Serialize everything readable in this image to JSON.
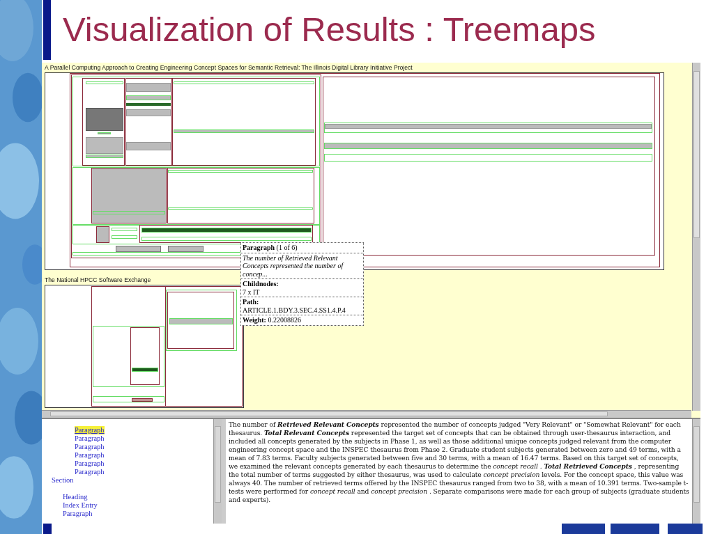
{
  "slide_title": "Visualization of Results : Treemaps",
  "treemaps": [
    {
      "title": "A Parallel Computing Approach to Creating Engineering Concept Spaces for Semantic Retrieval: The Illinois Digital Library Initiative Project"
    },
    {
      "title": "The National HPCC Software Exchange"
    }
  ],
  "tooltip": {
    "heading": "Paragraph",
    "count": "(1 of 6)",
    "snippet": "The number of Retrieved Relevant Concepts represented the number of concep...",
    "childnodes_label": "Childnodes:",
    "childnodes": "7 x IT",
    "path_label": "Path:",
    "path": "ARTICLE.1.BDY.3.SEC.4.SS1.4.P.4",
    "weight_label": "Weight:",
    "weight": "0.22008826"
  },
  "outline": [
    {
      "children": [
        {
          "label": "Paragraph",
          "selected": true
        },
        {
          "label": "Paragraph",
          "selected": false
        },
        {
          "label": "Paragraph",
          "selected": false
        },
        {
          "label": "Paragraph",
          "selected": false
        },
        {
          "label": "Paragraph",
          "selected": false
        },
        {
          "label": "Paragraph",
          "selected": false
        }
      ]
    },
    {
      "label": "Section",
      "selected": false,
      "children": [
        {
          "label": "Heading",
          "selected": false
        },
        {
          "label": "Index Entry",
          "selected": false
        },
        {
          "label": "Paragraph",
          "selected": false
        }
      ]
    }
  ],
  "document_text": "The number of **Retrieved Relevant Concepts** represented the number of concepts judged \"Very Relevant\" or \"Somewhat Relevant\" for each thesaurus. **Total Relevant Concepts** represented the target set of concepts that can be obtained through user-thesaurus interaction, and included all concepts generated by the subjects in Phase 1, as well as those additional unique concepts judged relevant from the computer engineering concept space and the INSPEC thesaurus from Phase 2. Graduate student subjects generated between zero and 49 terms, with a mean of 7.83 terms. Faculty subjects generated between five and 30 terms, with a mean of 16.47 terms. Based on this target set of concepts, we examined the relevant concepts generated by each thesaurus to determine the *concept recall* . **Total Retrieved Concepts** , representing the total number of terms suggested by either thesaurus, was used to calculate *concept precision* levels. For the concept space, this value was always 40. The number of retrieved terms offered by the INSPEC thesaurus ranged from two to 38, with a mean of 10.391 terms. Two-sample t-tests were performed for *concept recall* and *concept precision* . Separate comparisons were made for each group of subjects (graduate students and experts)."
}
